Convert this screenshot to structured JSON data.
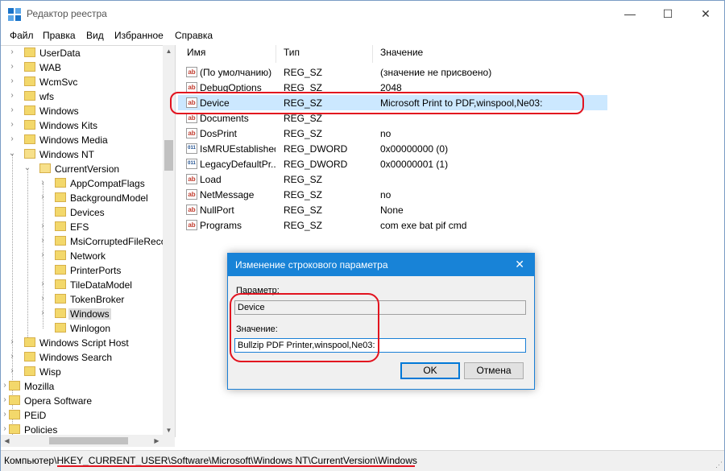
{
  "window": {
    "title": "Редактор реестра",
    "controls": {
      "minimize": "—",
      "maximize": "☐",
      "close": "✕"
    }
  },
  "menu": [
    "Файл",
    "Правка",
    "Вид",
    "Избранное",
    "Справка"
  ],
  "tree": [
    {
      "label": "UserData",
      "arrow": "›"
    },
    {
      "label": "WAB",
      "arrow": "›"
    },
    {
      "label": "WcmSvc",
      "arrow": "›"
    },
    {
      "label": "wfs",
      "arrow": "›"
    },
    {
      "label": "Windows",
      "arrow": "›"
    },
    {
      "label": "Windows Kits",
      "arrow": "›"
    },
    {
      "label": "Windows Media",
      "arrow": "›"
    },
    {
      "label": "Windows NT",
      "arrow": "⌄"
    },
    {
      "label": "CurrentVersion",
      "arrow": "⌄"
    },
    {
      "label": "AppCompatFlags",
      "arrow": "›"
    },
    {
      "label": "BackgroundModel",
      "arrow": "›"
    },
    {
      "label": "Devices",
      "arrow": ""
    },
    {
      "label": "EFS",
      "arrow": "›"
    },
    {
      "label": "MsiCorruptedFileReco",
      "arrow": "›"
    },
    {
      "label": "Network",
      "arrow": "›"
    },
    {
      "label": "PrinterPorts",
      "arrow": ""
    },
    {
      "label": "TileDataModel",
      "arrow": "›"
    },
    {
      "label": "TokenBroker",
      "arrow": "›"
    },
    {
      "label": "Windows",
      "arrow": "›"
    },
    {
      "label": "Winlogon",
      "arrow": ""
    },
    {
      "label": "Windows Script Host",
      "arrow": "›"
    },
    {
      "label": "Windows Search",
      "arrow": "›"
    },
    {
      "label": "Wisp",
      "arrow": "›"
    },
    {
      "label": "Mozilla",
      "arrow": "›"
    },
    {
      "label": "Opera Software",
      "arrow": "›"
    },
    {
      "label": "PEiD",
      "arrow": "›"
    },
    {
      "label": "Policies",
      "arrow": "›"
    }
  ],
  "values": {
    "headers": {
      "name": "Имя",
      "type": "Тип",
      "data": "Значение"
    },
    "rows": [
      {
        "icon": "ab",
        "name": "(По умолчанию)",
        "type": "REG_SZ",
        "data": "(значение не присвоено)"
      },
      {
        "icon": "ab",
        "name": "DebugOptions",
        "type": "REG_SZ",
        "data": "2048"
      },
      {
        "icon": "ab",
        "name": "Device",
        "type": "REG_SZ",
        "data": "Microsoft Print to PDF,winspool,Ne03:"
      },
      {
        "icon": "ab",
        "name": "Documents",
        "type": "REG_SZ",
        "data": ""
      },
      {
        "icon": "ab",
        "name": "DosPrint",
        "type": "REG_SZ",
        "data": "no"
      },
      {
        "icon": "011",
        "name": "IsMRUEstablished",
        "type": "REG_DWORD",
        "data": "0x00000000 (0)"
      },
      {
        "icon": "011",
        "name": "LegacyDefaultPr...",
        "type": "REG_DWORD",
        "data": "0x00000001 (1)"
      },
      {
        "icon": "ab",
        "name": "Load",
        "type": "REG_SZ",
        "data": ""
      },
      {
        "icon": "ab",
        "name": "NetMessage",
        "type": "REG_SZ",
        "data": "no"
      },
      {
        "icon": "ab",
        "name": "NullPort",
        "type": "REG_SZ",
        "data": "None"
      },
      {
        "icon": "ab",
        "name": "Programs",
        "type": "REG_SZ",
        "data": "com exe bat pif cmd"
      }
    ]
  },
  "dialog": {
    "title": "Изменение строкового параметра",
    "close": "✕",
    "param_label": "Параметр:",
    "param_value": "Device",
    "value_label": "Значение:",
    "value_value": "Bullzip PDF Printer,winspool,Ne03:",
    "ok": "OK",
    "cancel": "Отмена"
  },
  "status": {
    "path": "Компьютер\\HKEY_CURRENT_USER\\Software\\Microsoft\\Windows NT\\CurrentVersion\\Windows"
  },
  "accent": {
    "selection": "#cce8ff",
    "highlight": "#e2131f",
    "dialog_title": "#1883d7"
  }
}
